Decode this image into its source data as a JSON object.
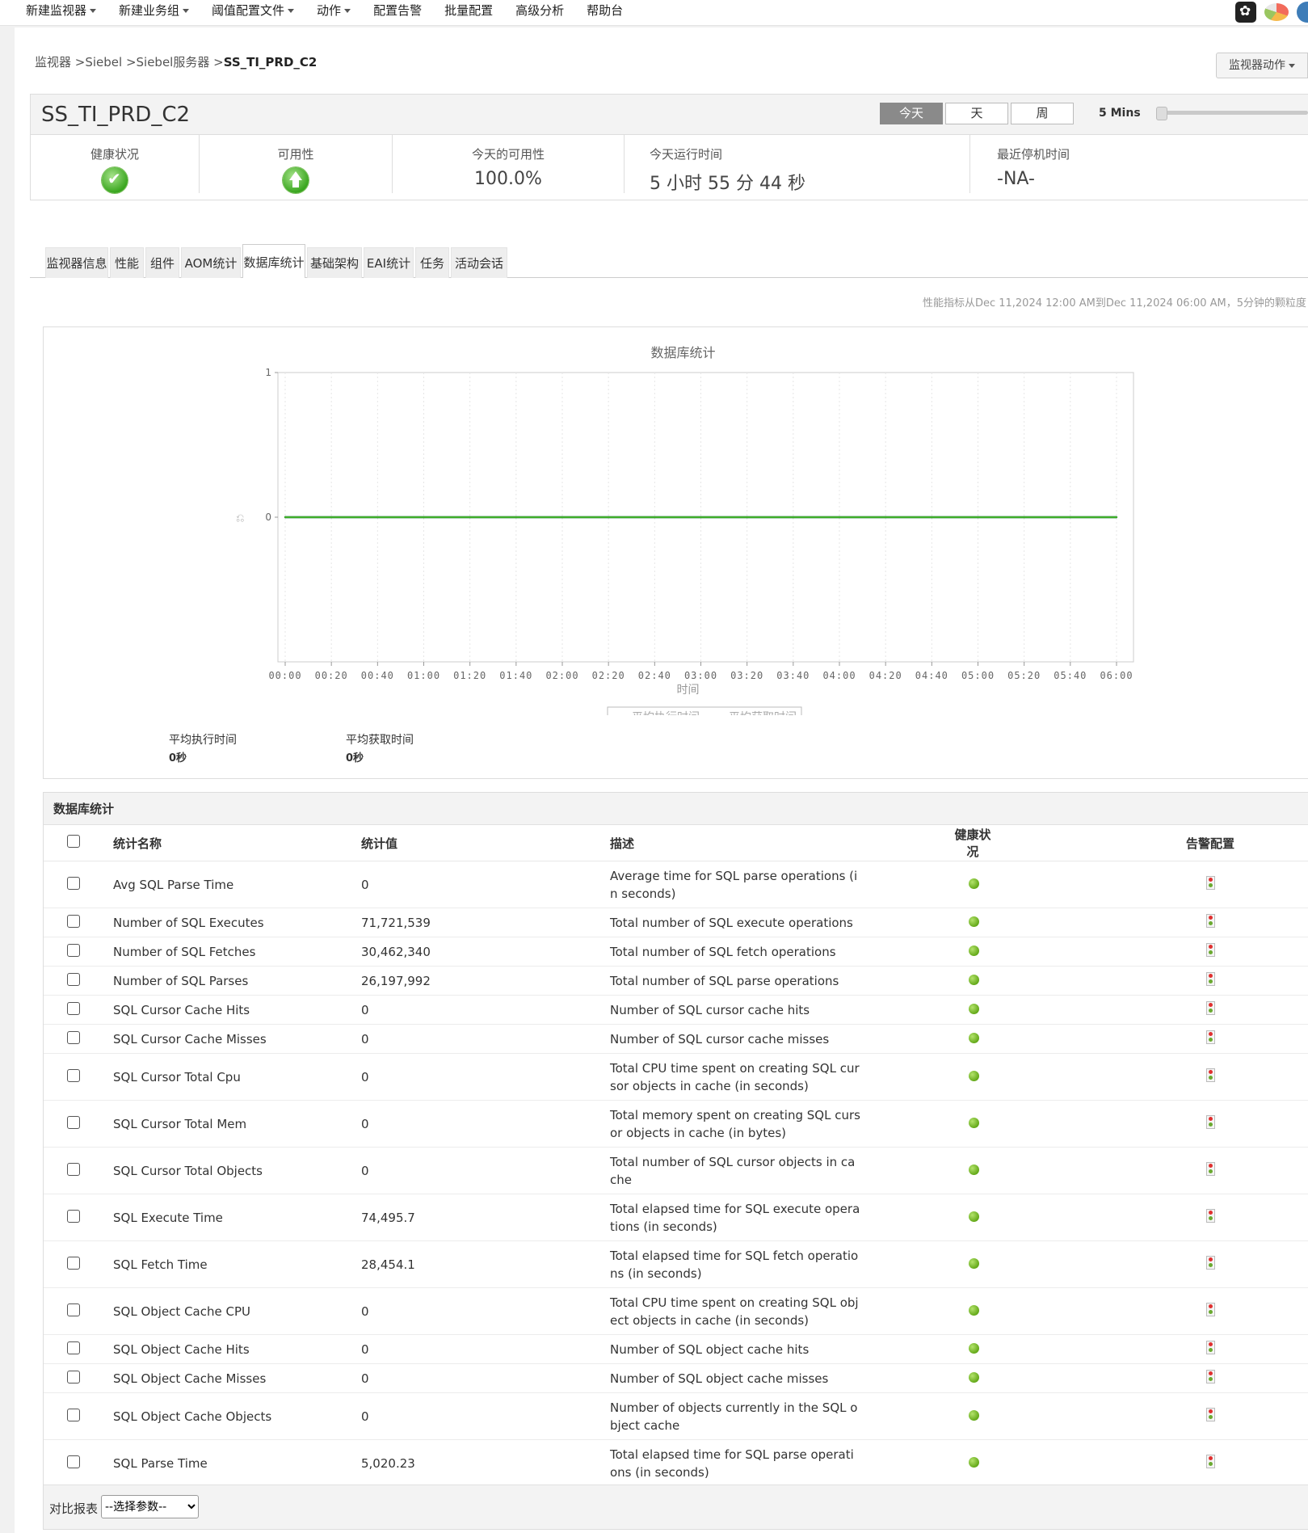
{
  "nav": {
    "items": [
      {
        "label": "新建监视器",
        "caret": true
      },
      {
        "label": "新建业务组",
        "caret": true
      },
      {
        "label": "阈值配置文件",
        "caret": true
      },
      {
        "label": "动作",
        "caret": true
      },
      {
        "label": "配置告警",
        "caret": false
      },
      {
        "label": "批量配置",
        "caret": false
      },
      {
        "label": "高级分析",
        "caret": false
      },
      {
        "label": "帮助台",
        "caret": false
      }
    ],
    "icons": [
      "settings-icon",
      "pie-chart-icon",
      "globe-icon"
    ]
  },
  "breadcrumb": {
    "path": "监视器 >Siebel >Siebel服务器 >",
    "current": "SS_TI_PRD_C2"
  },
  "monitor_actions": {
    "label": "监视器动作"
  },
  "header": {
    "title": "SS_TI_PRD_C2",
    "periods": [
      "今天",
      "天",
      "周"
    ],
    "active_period": "今天",
    "interval": "5 Mins",
    "slider_position": 0.0
  },
  "stats": {
    "health_label": "健康状况",
    "availability_label": "可用性",
    "today_avail_label": "今天的可用性",
    "today_avail_value": "100.0%",
    "uptime_label": "今天运行时间",
    "uptime_value": "5 小时 55 分 44 秒",
    "downtime_label": "最近停机时间",
    "downtime_value": "-NA-"
  },
  "tabs": [
    "监视器信息",
    "性能",
    "组件",
    "AOM统计",
    "数据库统计",
    "基础架构",
    "EAI统计",
    "任务",
    "活动会话"
  ],
  "active_tab": "数据库统计",
  "range_text": "性能指标从Dec 11,2024 12:00 AM到Dec 11,2024 06:00 AM，5分钟的颗粒度",
  "chart_data": {
    "type": "line",
    "title": "数据库统计",
    "xlabel": "时间",
    "ylabel": "",
    "ylim": [
      -1,
      1
    ],
    "yticks": [
      0,
      1
    ],
    "x": [
      "00:00",
      "00:20",
      "00:40",
      "01:00",
      "01:20",
      "01:40",
      "02:00",
      "02:20",
      "02:40",
      "03:00",
      "03:20",
      "03:40",
      "04:00",
      "04:20",
      "04:40",
      "05:00",
      "05:20",
      "05:40",
      "06:00"
    ],
    "series": [
      {
        "name": "平均执行时间",
        "color": "#3fae29",
        "values": [
          0,
          0,
          0,
          0,
          0,
          0,
          0,
          0,
          0,
          0,
          0,
          0,
          0,
          0,
          0,
          0,
          0,
          0,
          0
        ]
      },
      {
        "name": "平均获取时间",
        "color": "#2a3fa8",
        "values": [
          0,
          0,
          0,
          0,
          0,
          0,
          0,
          0,
          0,
          0,
          0,
          0,
          0,
          0,
          0,
          0,
          0,
          0,
          0
        ]
      }
    ],
    "grid": true,
    "legend": "bottom-center"
  },
  "chart_summary": [
    {
      "label": "平均执行时间",
      "value": "0秒"
    },
    {
      "label": "平均获取时间",
      "value": "0秒"
    }
  ],
  "table": {
    "title": "数据库统计",
    "columns": [
      "统计名称",
      "统计值",
      "描述",
      "健康状况",
      "告警配置"
    ],
    "rows": [
      {
        "name": "Avg SQL Parse Time",
        "value": "0",
        "desc": [
          "Average time for SQL parse operations (i",
          "n seconds)"
        ]
      },
      {
        "name": "Number of SQL Executes",
        "value": "71,721,539",
        "desc": [
          "Total number of SQL execute operations"
        ]
      },
      {
        "name": "Number of SQL Fetches",
        "value": "30,462,340",
        "desc": [
          "Total number of SQL fetch operations"
        ]
      },
      {
        "name": "Number of SQL Parses",
        "value": "26,197,992",
        "desc": [
          "Total number of SQL parse operations"
        ]
      },
      {
        "name": "SQL Cursor Cache Hits",
        "value": "0",
        "desc": [
          "Number of SQL cursor cache hits"
        ]
      },
      {
        "name": "SQL Cursor Cache Misses",
        "value": "0",
        "desc": [
          "Number of SQL cursor cache misses"
        ]
      },
      {
        "name": "SQL Cursor Total Cpu",
        "value": "0",
        "desc": [
          "Total CPU time spent on creating SQL cur",
          "sor objects in cache (in seconds)"
        ]
      },
      {
        "name": "SQL Cursor Total Mem",
        "value": "0",
        "desc": [
          "Total memory spent on creating SQL curs",
          "or objects in cache (in bytes)"
        ]
      },
      {
        "name": "SQL Cursor Total Objects",
        "value": "0",
        "desc": [
          "Total number of SQL cursor objects in ca",
          "che"
        ]
      },
      {
        "name": "SQL Execute Time",
        "value": "74,495.7",
        "desc": [
          "Total elapsed time for SQL execute opera",
          "tions (in seconds)"
        ]
      },
      {
        "name": "SQL Fetch Time",
        "value": "28,454.1",
        "desc": [
          "Total elapsed time for SQL fetch operatio",
          "ns (in seconds)"
        ]
      },
      {
        "name": "SQL Object Cache CPU",
        "value": "0",
        "desc": [
          "Total CPU time spent on creating SQL obj",
          "ect objects in cache (in seconds)"
        ]
      },
      {
        "name": "SQL Object Cache Hits",
        "value": "0",
        "desc": [
          "Number of SQL object cache hits"
        ]
      },
      {
        "name": "SQL Object Cache Misses",
        "value": "0",
        "desc": [
          "Number of SQL object cache misses"
        ]
      },
      {
        "name": "SQL Object Cache Objects",
        "value": "0",
        "desc": [
          "Number of objects currently in the SQL o",
          "bject cache"
        ]
      },
      {
        "name": "SQL Parse Time",
        "value": "5,020.23",
        "desc": [
          "Total elapsed time for SQL parse operati",
          "ons (in seconds)"
        ]
      }
    ]
  },
  "compare": {
    "label": "对比报表",
    "select": "--选择参数--"
  }
}
